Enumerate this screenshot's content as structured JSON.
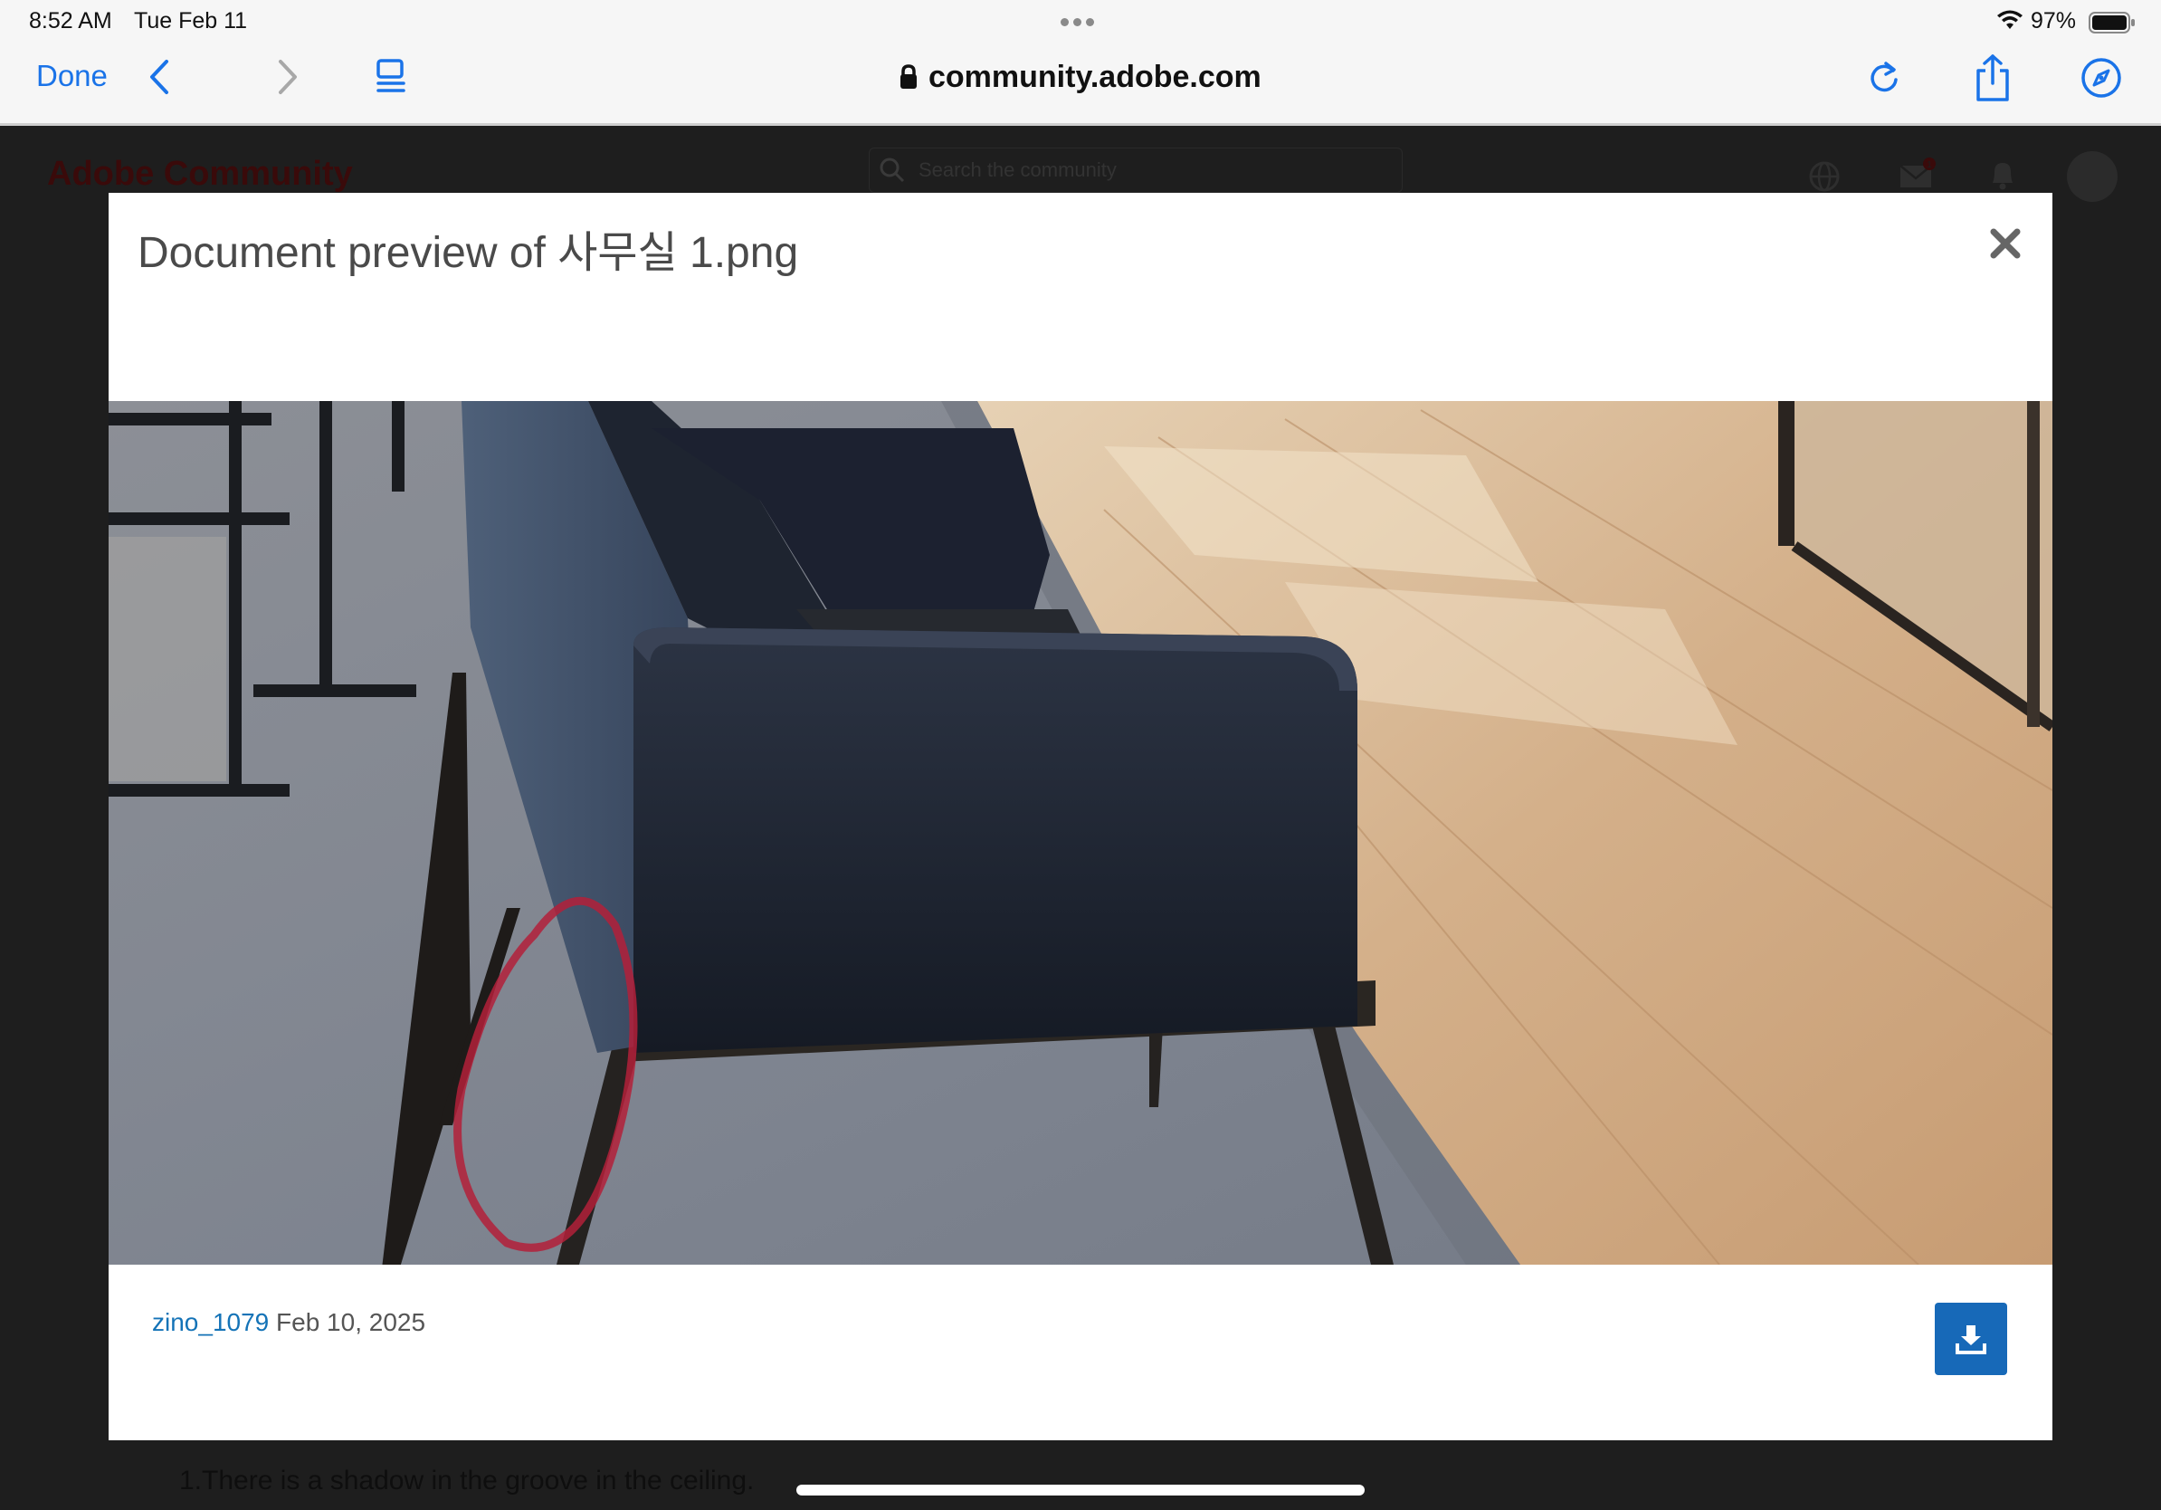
{
  "status_bar": {
    "time": "8:52 AM",
    "date": "Tue Feb 11",
    "battery_percent": "97%"
  },
  "browser": {
    "done_label": "Done",
    "url": "community.adobe.com",
    "accent_color": "#1a73e8"
  },
  "background_page": {
    "logo": "Adobe Community",
    "search_placeholder": "Search the community",
    "notification_count": "1",
    "body_text": "1.There is a shadow in the groove in the ceiling."
  },
  "modal": {
    "title": "Document preview of 사무실 1.png",
    "author": "zino_1079",
    "date": "Feb 10, 2025",
    "download_color": "#1769b8"
  }
}
